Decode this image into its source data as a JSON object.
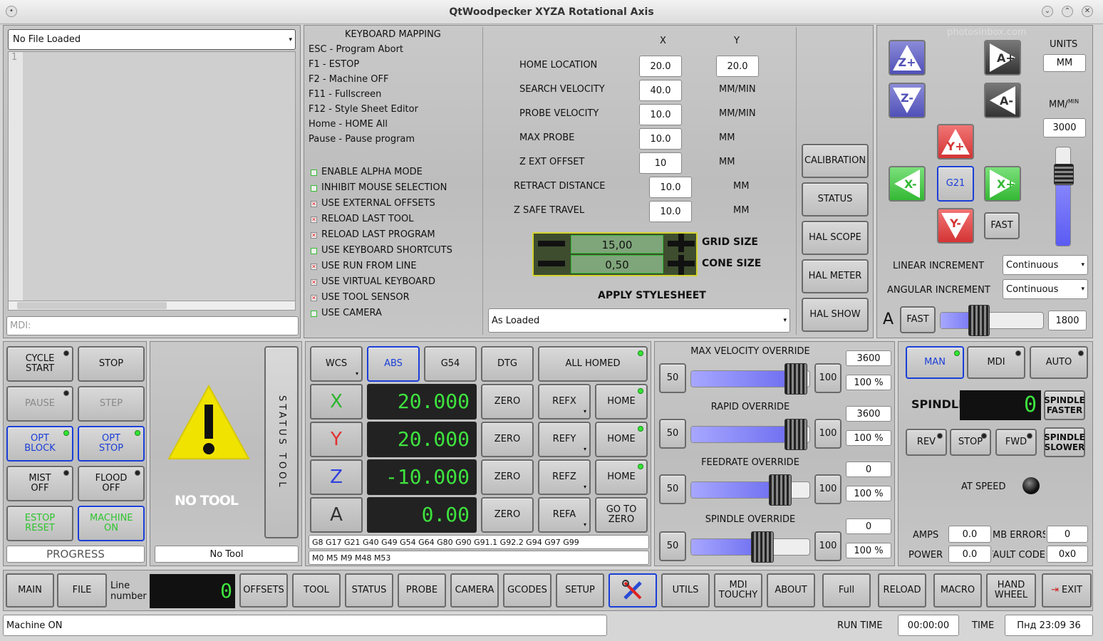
{
  "window": {
    "title": "QtWoodpecker XYZA Rotational Axis",
    "watermark": "photosinbox.com"
  },
  "file": {
    "name": "No File Loaded",
    "line1": "1",
    "mdi_placeholder": "MDI:"
  },
  "keymap": {
    "title": "KEYBOARD MAPPING",
    "lines": [
      "ESC - Program Abort",
      "F1 - ESTOP",
      "F2 - Machine OFF",
      "F11 - Fullscreen",
      "F12 - Style Sheet Editor",
      "Home - HOME All",
      "Pause - Pause program"
    ]
  },
  "options": [
    {
      "label": "ENABLE ALPHA MODE",
      "state": "on"
    },
    {
      "label": "INHIBIT MOUSE SELECTION",
      "state": "on"
    },
    {
      "label": "USE EXTERNAL OFFSETS",
      "state": "off"
    },
    {
      "label": "RELOAD LAST TOOL",
      "state": "off"
    },
    {
      "label": "RELOAD LAST PROGRAM",
      "state": "off"
    },
    {
      "label": "USE KEYBOARD SHORTCUTS",
      "state": "on"
    },
    {
      "label": "USE RUN FROM LINE",
      "state": "off"
    },
    {
      "label": "USE VIRTUAL KEYBOARD",
      "state": "off"
    },
    {
      "label": "USE TOOL SENSOR",
      "state": "off"
    },
    {
      "label": "USE CAMERA",
      "state": "on"
    }
  ],
  "probe": {
    "col_x": "X",
    "col_y": "Y",
    "rows": [
      {
        "label": "HOME LOCATION",
        "v1": "20.0",
        "v2": "20.0",
        "unit": ""
      },
      {
        "label": "SEARCH VELOCITY",
        "v1": "40.0",
        "v2": "",
        "unit": "MM/MIN"
      },
      {
        "label": "PROBE VELOCITY",
        "v1": "10.0",
        "v2": "",
        "unit": "MM/MIN"
      },
      {
        "label": "MAX PROBE",
        "v1": "10.0",
        "v2": "",
        "unit": "MM"
      },
      {
        "label": "Z EXT OFFSET",
        "v1": "10",
        "v2": "",
        "unit": "MM"
      },
      {
        "label": "RETRACT DISTANCE",
        "v1": "10.0",
        "v2": "",
        "unit": "MM"
      },
      {
        "label": "Z SAFE TRAVEL",
        "v1": "10.0",
        "v2": "",
        "unit": "MM"
      }
    ],
    "grid_size": "15,00",
    "cone_size": "0,50",
    "grid_label": "GRID SIZE",
    "cone_label": "CONE SIZE",
    "stylesheet_label": "APPLY STYLESHEET",
    "stylesheet_value": "As Loaded"
  },
  "side_buttons": [
    "CALIBRATION",
    "STATUS",
    "HAL SCOPE",
    "HAL METER",
    "HAL SHOW"
  ],
  "jog": {
    "units_label": "UNITS",
    "units": "MM",
    "rate_label": "MM/",
    "rate_sup": "MIN",
    "rate": "3000",
    "rate_level": 0.72,
    "g21": "G21",
    "fast": "FAST",
    "linear_label": "LINEAR INCREMENT",
    "linear_value": "Continuous",
    "angular_label": "ANGULAR INCREMENT",
    "angular_value": "Continuous",
    "a_label": "A",
    "a_fast": "FAST",
    "a_rate": "1800",
    "a_level": 0.38,
    "zplus": "Z+",
    "zminus": "Z-",
    "aplus": "A+",
    "aminus": "A-",
    "yplus": "Y+",
    "yminus": "Y-",
    "xplus": "X+",
    "xminus": "X-"
  },
  "controls": {
    "cycle_start": "CYCLE START",
    "stop": "STOP",
    "pause": "PAUSE",
    "step": "STEP",
    "opt_block": "OPT BLOCK",
    "opt_stop": "OPT STOP",
    "mist": "MIST OFF",
    "flood": "FLOOD OFF",
    "estop": "ESTOP RESET",
    "machine": "MACHINE ON",
    "progress": "PROGRESS"
  },
  "tool": {
    "no_tool": "NO TOOL",
    "status_tool": "STATUS TOOL",
    "tool_name": "No Tool"
  },
  "dro": {
    "wcs": "WCS",
    "abs": "ABS",
    "g54": "G54",
    "dtg": "DTG",
    "all_homed": "ALL HOMED",
    "axes": [
      {
        "name": "X",
        "value": "20.000",
        "ref": "REFX",
        "home": "HOME",
        "color": "#2bb52b"
      },
      {
        "name": "Y",
        "value": "20.000",
        "ref": "REFY",
        "home": "HOME",
        "color": "#e03030"
      },
      {
        "name": "Z",
        "value": "-10.000",
        "ref": "REFZ",
        "home": "HOME",
        "color": "#3040e0"
      },
      {
        "name": "A",
        "value": "0.00",
        "ref": "REFA",
        "home": "GO TO ZERO",
        "color": "#333333"
      }
    ],
    "zero": "ZERO",
    "gcodes": "G8 G17 G21 G40 G49 G54 G64 G80 G90 G91.1 G92.2 G94 G97 G99",
    "mcodes": "M0 M5 M9 M48 M53"
  },
  "overrides": [
    {
      "title": "MAX VELOCITY OVERRIDE",
      "low": "50",
      "high": "100",
      "value": "3600",
      "pct": "100 %",
      "level": 0.88
    },
    {
      "title": "RAPID OVERRIDE",
      "low": "50",
      "high": "100",
      "value": "3600",
      "pct": "100 %",
      "level": 0.88
    },
    {
      "title": "FEEDRATE OVERRIDE",
      "low": "50",
      "high": "100",
      "value": "0",
      "pct": "100 %",
      "level": 0.75
    },
    {
      "title": "SPINDLE OVERRIDE",
      "low": "50",
      "high": "100",
      "value": "0",
      "pct": "100 %",
      "level": 0.6
    }
  ],
  "spindle": {
    "man": "MAN",
    "mdi": "MDI",
    "auto": "AUTO",
    "label": "SPINDLE",
    "rpm": "0",
    "faster": "SPINDLE FASTER",
    "slower": "SPINDLE SLOWER",
    "rev": "REV",
    "stop": "STOP",
    "fwd": "FWD",
    "at_speed": "AT SPEED",
    "amps_label": "AMPS",
    "amps": "0.0",
    "mb_label": "MB ERRORS",
    "mb": "0",
    "power_label": "POWER",
    "power": "0.0",
    "fault_label": "FAULT CODE",
    "fault": "0x0"
  },
  "bottom": {
    "main": "MAIN",
    "file": "FILE",
    "line_label": "Line number",
    "line_value": "0",
    "offsets": "OFFSETS",
    "tool": "TOOL",
    "status": "STATUS",
    "probe": "PROBE",
    "camera": "CAMERA",
    "gcodes": "GCODES",
    "setup": "SETUP",
    "utils": "UTILS",
    "mdi_touchy": "MDI TOUCHY",
    "about": "ABOUT",
    "full": "Full",
    "reload": "RELOAD",
    "macro": "MACRO",
    "hand_wheel": "HAND WHEEL",
    "exit": "EXIT"
  },
  "status": {
    "message": "Machine ON",
    "run_time_label": "RUN TIME",
    "run_time": "00:00:00",
    "time_label": "TIME",
    "time": "Пнд 23:09 36"
  }
}
